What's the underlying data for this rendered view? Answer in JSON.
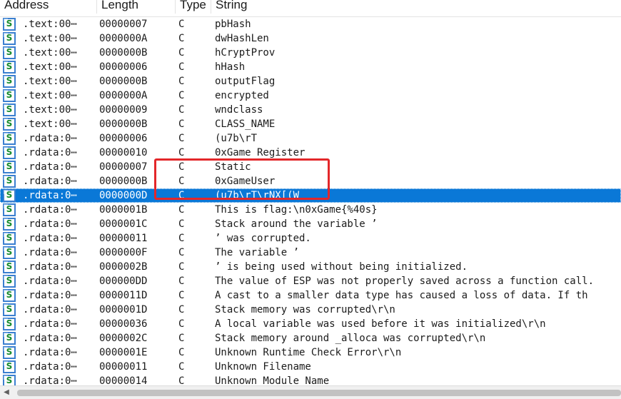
{
  "header": {
    "col_address": "Address",
    "col_length": "Length",
    "col_type": "Type",
    "col_string": "String"
  },
  "icon_glyph": "S",
  "selected_index": 12,
  "colors": {
    "selection": "#0a78d7",
    "highlight_box": "#e3272a",
    "icon_border": "#3a7fd0",
    "icon_glyph": "#158a2e"
  },
  "rows": [
    {
      "address": ".text:00⋯",
      "length": "00000007",
      "type": "C",
      "string": "pbHash"
    },
    {
      "address": ".text:00⋯",
      "length": "0000000A",
      "type": "C",
      "string": "dwHashLen"
    },
    {
      "address": ".text:00⋯",
      "length": "0000000B",
      "type": "C",
      "string": "hCryptProv"
    },
    {
      "address": ".text:00⋯",
      "length": "00000006",
      "type": "C",
      "string": "hHash"
    },
    {
      "address": ".text:00⋯",
      "length": "0000000B",
      "type": "C",
      "string": "outputFlag"
    },
    {
      "address": ".text:00⋯",
      "length": "0000000A",
      "type": "C",
      "string": "encrypted"
    },
    {
      "address": ".text:00⋯",
      "length": "00000009",
      "type": "C",
      "string": "wndclass"
    },
    {
      "address": ".text:00⋯",
      "length": "0000000B",
      "type": "C",
      "string": "CLASS_NAME"
    },
    {
      "address": ".rdata:0⋯",
      "length": "00000006",
      "type": "C",
      "string": "(u7b\\rT"
    },
    {
      "address": ".rdata:0⋯",
      "length": "00000010",
      "type": "C",
      "string": "0xGame Register"
    },
    {
      "address": ".rdata:0⋯",
      "length": "00000007",
      "type": "C",
      "string": "Static"
    },
    {
      "address": ".rdata:0⋯",
      "length": "0000000B",
      "type": "C",
      "string": "0xGameUser"
    },
    {
      "address": ".rdata:0⋯",
      "length": "0000000D",
      "type": "C",
      "string": "(u7b\\rT\\rNX[(W"
    },
    {
      "address": ".rdata:0⋯",
      "length": "0000001B",
      "type": "C",
      "string": "This is flag:\\n0xGame{%40s}"
    },
    {
      "address": ".rdata:0⋯",
      "length": "0000001C",
      "type": "C",
      "string": "Stack around the variable ’"
    },
    {
      "address": ".rdata:0⋯",
      "length": "00000011",
      "type": "C",
      "string": "’ was corrupted."
    },
    {
      "address": ".rdata:0⋯",
      "length": "0000000F",
      "type": "C",
      "string": "The variable ’"
    },
    {
      "address": ".rdata:0⋯",
      "length": "0000002B",
      "type": "C",
      "string": "’ is being used without being initialized."
    },
    {
      "address": ".rdata:0⋯",
      "length": "000000DD",
      "type": "C",
      "string": "The value of ESP was not properly saved across a function call."
    },
    {
      "address": ".rdata:0⋯",
      "length": "0000011D",
      "type": "C",
      "string": "A cast to a smaller data type has caused a loss of data.  If th"
    },
    {
      "address": ".rdata:0⋯",
      "length": "0000001D",
      "type": "C",
      "string": "Stack memory was corrupted\\r\\n"
    },
    {
      "address": ".rdata:0⋯",
      "length": "00000036",
      "type": "C",
      "string": "A local variable was used before it was initialized\\r\\n"
    },
    {
      "address": ".rdata:0⋯",
      "length": "0000002C",
      "type": "C",
      "string": "Stack memory around _alloca was corrupted\\r\\n"
    },
    {
      "address": ".rdata:0⋯",
      "length": "0000001E",
      "type": "C",
      "string": "Unknown Runtime Check Error\\r\\n"
    },
    {
      "address": ".rdata:0⋯",
      "length": "00000011",
      "type": "C",
      "string": "Unknown Filename"
    },
    {
      "address": ".rdata:0⋯",
      "length": "00000014",
      "type": "C",
      "string": "Unknown Module Name"
    }
  ],
  "scrollbar": {
    "left_arrow_icon": "scroll-left-arrow-icon"
  }
}
